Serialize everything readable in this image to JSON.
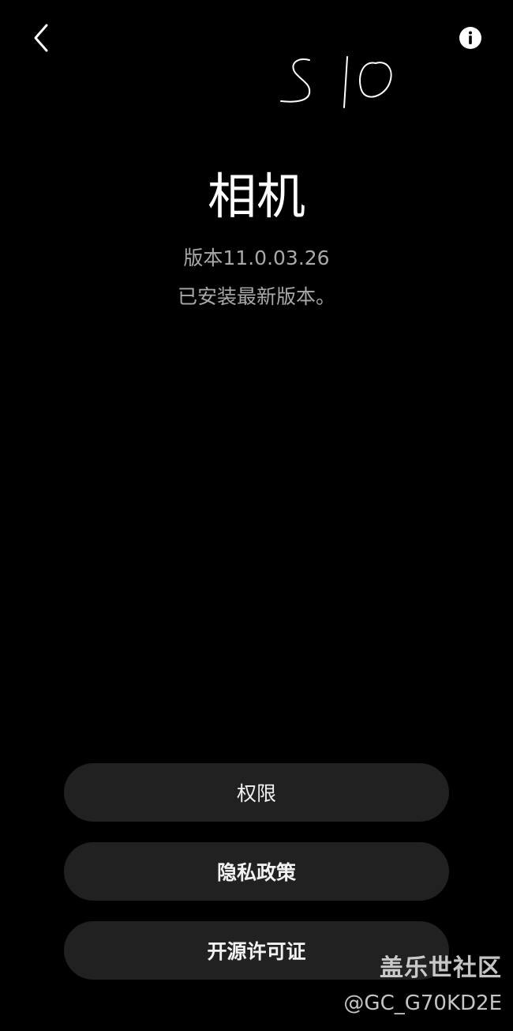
{
  "header": {
    "back_icon": "chevron-left-icon",
    "info_icon": "info-circle-icon"
  },
  "annotation": {
    "handwritten_text": "S10"
  },
  "app": {
    "title": "相机",
    "version": "版本11.0.03.26",
    "status": "已安装最新版本。"
  },
  "actions": {
    "permissions_label": "权限",
    "privacy_label": "隐私政策",
    "license_label": "开源许可证"
  },
  "watermark": {
    "site": "盖乐世社区",
    "user": "@GC_G70KD2E"
  },
  "colors": {
    "background": "#000000",
    "button_bg": "#212121",
    "secondary_text": "#a9a9a9"
  }
}
